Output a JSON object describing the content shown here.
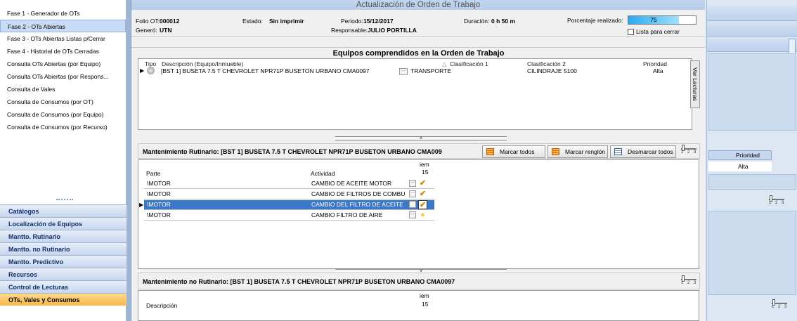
{
  "nav": {
    "items": [
      "Fase 1 - Generador de OTs",
      "Fase 2 - OTs Abiertas",
      "Fase 3 - OTs Abiertas Listas p/Cerrar",
      "Fase 4 - Historial de OTs Cerradas",
      "Consulta OTs Abiertas (por Equipo)",
      "Consulta OTs Abiertas (por Respons...",
      "Consulta de Vales",
      "Consulta de Consumos (por OT)",
      "Consulta de Consumos (por Equipo)",
      "Consulta de Consumos (por Recurso)"
    ],
    "categories": [
      "Catálogos",
      "Localización de Equipos",
      "Mantto. Rutinario",
      "Mantto. no Rutinario",
      "Mantto. Predictivo",
      "Recursos",
      "Control de Lecturas",
      "OTs, Vales y Consumos"
    ]
  },
  "dialog": {
    "title": "Actualización de Orden de Trabajo",
    "folio_label": "Folio OT:",
    "folio": "000012",
    "genero_label": "Generó:",
    "genero": "UTN",
    "estado_label": "Estado:",
    "estado": "Sin imprimir",
    "periodo_label": "Periodo:",
    "periodo": "15/12/2017",
    "responsable_label": "Responsable:",
    "responsable": "JULIO PORTILLA",
    "duracion_label": "Duración:",
    "duracion": "0 h 50 m",
    "porcentaje_label": "Porcentaje realizado:",
    "porcentaje": "75",
    "porcentaje_fraction": 0.75,
    "lista_label": "Lista para cerrar"
  },
  "equipos": {
    "title": "Equipos comprendidos en la Orden de Trabajo",
    "headers": {
      "tipo": "Tipo",
      "descripcion": "Descripción (Equipo/Inmueble)",
      "clas1": "Clasificación 1",
      "clas2": "Clasificación 2",
      "prioridad": "Prioridad"
    },
    "row": {
      "descripcion": "[BST 1] BUSETA 7.5 T CHEVROLET NPR71P BUSETON URBANO CMA0097",
      "clas1": "TRANSPORTE",
      "clas2": "CILINDRAJE 5100",
      "prioridad": "Alta"
    },
    "ver_lecturas": "Ver Lecturas"
  },
  "rutinario": {
    "title": "Mantenimiento Rutinario: [BST 1] BUSETA 7.5 T CHEVROLET NPR71P BUSETON URBANO CMA009",
    "btn_marcar_todos": "Marcar todos",
    "btn_marcar_renglon": "Marcar renglón",
    "btn_desmarcar_todos": "Desmarcar todos",
    "col_parte": "Parte",
    "col_actividad": "Actividad",
    "col_item": "iem",
    "col_item_num": "15",
    "rows": [
      {
        "parte": "\\MOTOR",
        "actividad": "CAMBIO DE ACEITE MOTOR"
      },
      {
        "parte": "\\MOTOR",
        "actividad": "CAMBIO DE FILTROS DE COMBU"
      },
      {
        "parte": "\\MOTOR",
        "actividad": "CAMBIO DEL FILTRO DE ACEITE"
      },
      {
        "parte": "\\MOTOR",
        "actividad": "CAMBIO FILTRO DE AIRE"
      }
    ]
  },
  "no_rutinario": {
    "title": "Mantenimiento no Rutinario: [BST 1] BUSETA 7.5 T CHEVROLET NPR71P BUSETON URBANO CMA0097",
    "col_descripcion": "Descripción",
    "col_item": "iem",
    "col_item_num": "15"
  },
  "right_pane": {
    "header": "Prioridad",
    "value": "Alta"
  },
  "slider_labels": "1 2 3",
  "colors": {
    "accent": "#3b78c8",
    "active_category": "#f7b74a",
    "progress": "#2aa9f0"
  }
}
